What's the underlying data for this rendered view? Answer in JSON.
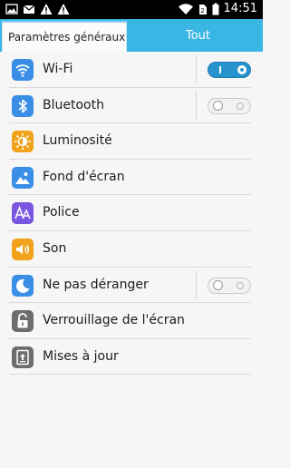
{
  "status_bar": {
    "time": "14:51",
    "left_icons": [
      "image-icon",
      "mail-icon",
      "warning-icon",
      "warning-icon"
    ],
    "right_icons": [
      "wifi-icon",
      "sim-icon",
      "battery-icon"
    ]
  },
  "tabs": {
    "general": "Paramètres généraux",
    "all": "Tout"
  },
  "settings": [
    {
      "label": "Wi-Fi",
      "icon": "wifi-icon",
      "color": "#3a8ee6",
      "toggle": "on"
    },
    {
      "label": "Bluetooth",
      "icon": "bluetooth-icon",
      "color": "#3a8ee6",
      "toggle": "off"
    },
    {
      "label": "Luminosité",
      "icon": "brightness-icon",
      "color": "#f0a21a"
    },
    {
      "label": "Fond d'écran",
      "icon": "wallpaper-icon",
      "color": "#3a8ee6"
    },
    {
      "label": "Police",
      "icon": "font-icon",
      "color": "#7a56e0"
    },
    {
      "label": "Son",
      "icon": "sound-icon",
      "color": "#f0a21a"
    },
    {
      "label": "Ne pas déranger",
      "icon": "moon-icon",
      "color": "#3a8ee6",
      "toggle": "off"
    },
    {
      "label": "Verrouillage de l'écran",
      "icon": "lock-icon",
      "color": "#6d6d6d"
    },
    {
      "label": "Mises à jour",
      "icon": "update-icon",
      "color": "#6d6d6d"
    }
  ],
  "colors": {
    "tab_bar": "#39b6e4",
    "toggle_on": "#2793cc"
  }
}
